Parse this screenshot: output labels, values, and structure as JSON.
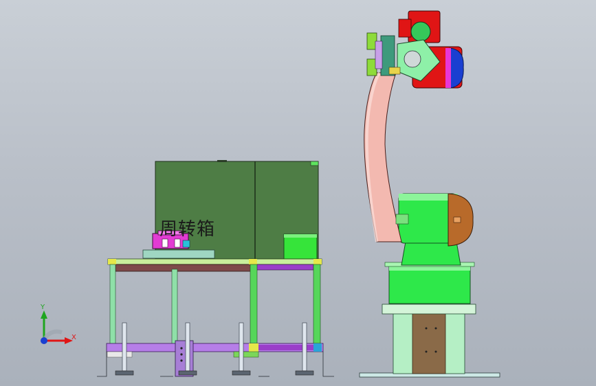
{
  "viewport": {
    "background_top": "#c9cfd6",
    "background_bottom": "#aab1bb"
  },
  "cabinet": {
    "label": "周转箱",
    "color": "#4e7d45"
  },
  "robot": {
    "base_color": "#2ee84a",
    "arm_color": "#f3b9b0",
    "head_color": "#e01515",
    "accent_color": "#1a3fd1"
  },
  "triad": {
    "x_label": "X",
    "y_label": "Y",
    "x_color": "#e01515",
    "y_color": "#1fa51f",
    "z_color": "#1a3fd1"
  }
}
